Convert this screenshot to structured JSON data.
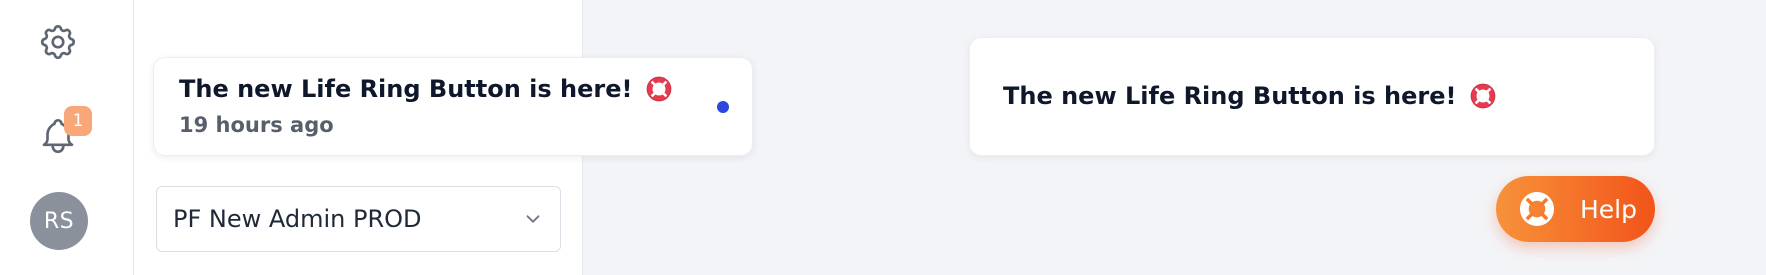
{
  "sidebar": {
    "settings_icon": "gear-icon",
    "notifications_icon": "bell-icon",
    "notification_count": "1",
    "user_initials": "RS"
  },
  "notifications": {
    "items": [
      {
        "title": "The new Life Ring Button is here!",
        "time": "19 hours ago",
        "icon": "life-ring-icon",
        "unread": true
      }
    ]
  },
  "workspace": {
    "selected": "PF New Admin PROD",
    "icon": "chevron-down-icon"
  },
  "announcement": {
    "title": "The new Life Ring Button is here!",
    "icon": "life-ring-icon"
  },
  "help_button": {
    "label": "Help",
    "icon": "life-ring-icon"
  },
  "colors": {
    "accent_start": "#f7923a",
    "accent_end": "#f2541a",
    "badge": "#f9a779",
    "unread_dot": "#2d46e0",
    "avatar_bg": "#8b919c",
    "life_ring_red": "#e43b4f"
  }
}
